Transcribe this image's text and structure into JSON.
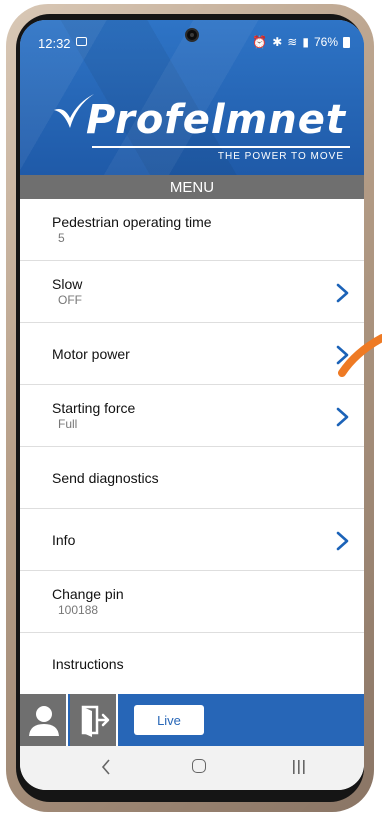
{
  "status": {
    "time": "12:32",
    "battery": "76%"
  },
  "brand": {
    "name": "Profelmnet",
    "tagline": "THE POWER TO MOVE"
  },
  "menu_title": "MENU",
  "items": [
    {
      "label": "Pedestrian operating time",
      "value": "5",
      "chevron": false
    },
    {
      "label": "Slow",
      "value": "OFF",
      "chevron": true
    },
    {
      "label": "Motor power",
      "value": "",
      "chevron": true
    },
    {
      "label": "Starting force",
      "value": "Full",
      "chevron": true
    },
    {
      "label": "Send diagnostics",
      "value": "",
      "chevron": false
    },
    {
      "label": "Info",
      "value": "",
      "chevron": true
    },
    {
      "label": "Change pin",
      "value": "100188",
      "chevron": false
    },
    {
      "label": "Instructions",
      "value": "",
      "chevron": false
    }
  ],
  "bottombar": {
    "live_label": "Live"
  },
  "colors": {
    "header_blue": "#2766b7",
    "chevron_blue": "#1c63b8",
    "menu_gray": "#6f6f6f",
    "swipe_orange": "#ee7a24"
  },
  "icons": {
    "user": "user-icon",
    "logout": "exit-door-icon",
    "chevron": "chevron-right-icon"
  }
}
